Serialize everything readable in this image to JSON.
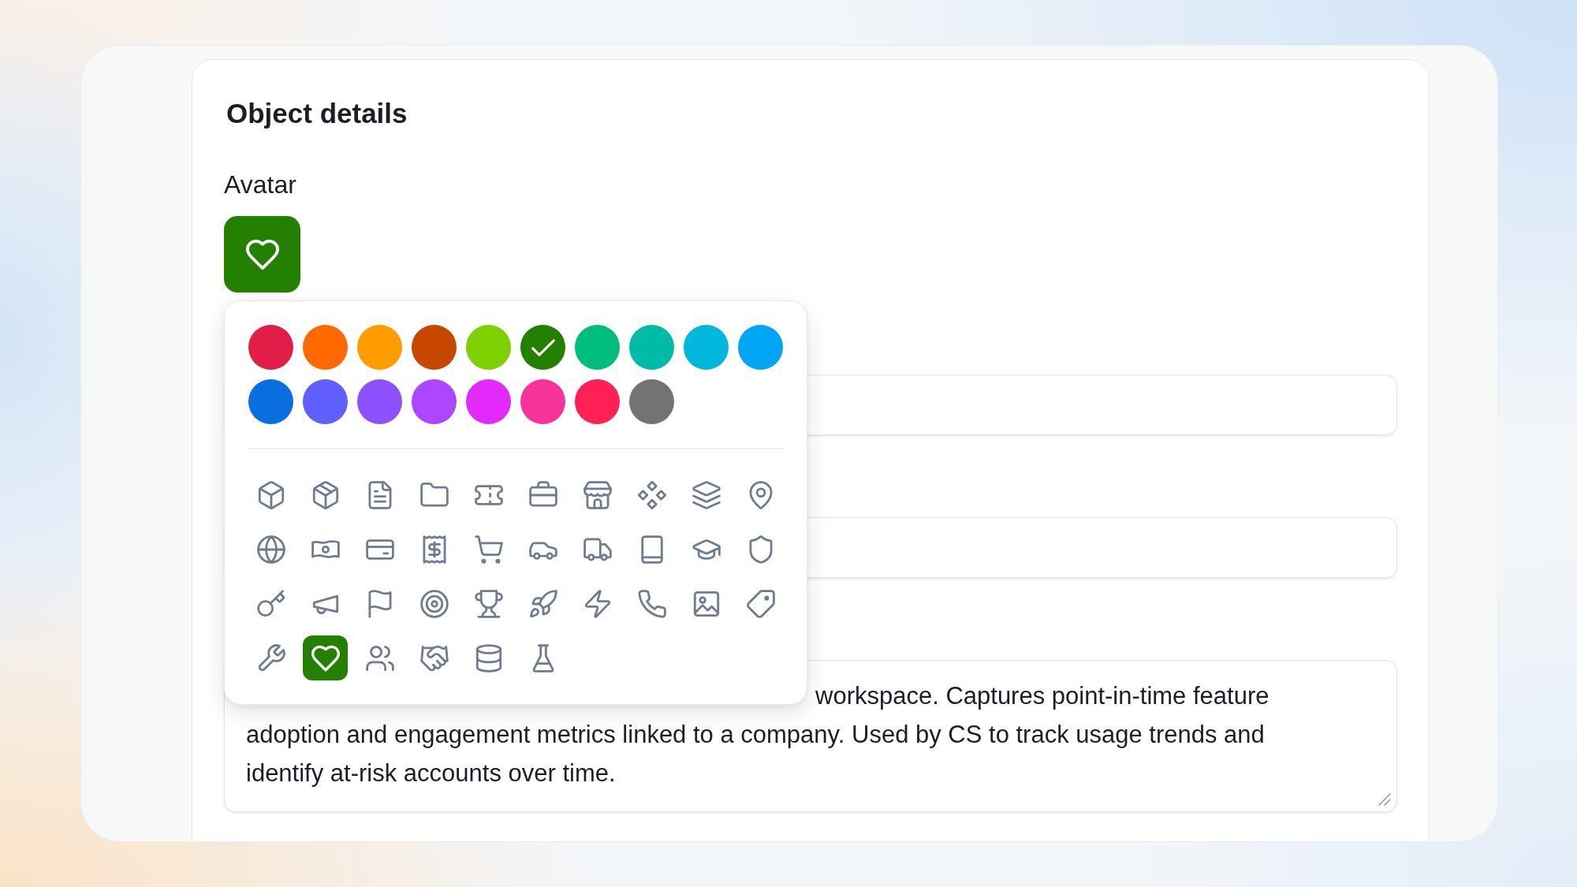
{
  "card": {
    "title": "Object details"
  },
  "avatar": {
    "label": "Avatar"
  },
  "picker": {
    "swatches": [
      {
        "color": "#e11d48",
        "selected": false
      },
      {
        "color": "#ff6900",
        "selected": false
      },
      {
        "color": "#ff9d00",
        "selected": false
      },
      {
        "color": "#c74600",
        "selected": false
      },
      {
        "color": "#7fd000",
        "selected": false
      },
      {
        "color": "#238000",
        "selected": true
      },
      {
        "color": "#00bc7d",
        "selected": false
      },
      {
        "color": "#00bba7",
        "selected": false
      },
      {
        "color": "#00b8db",
        "selected": false
      },
      {
        "color": "#00a6f4",
        "selected": false
      },
      {
        "color": "#0a6fde",
        "selected": false
      },
      {
        "color": "#615fff",
        "selected": false
      },
      {
        "color": "#8e51ff",
        "selected": false
      },
      {
        "color": "#ad46ff",
        "selected": false
      },
      {
        "color": "#e12afb",
        "selected": false
      },
      {
        "color": "#f6339a",
        "selected": false
      },
      {
        "color": "#ff2056",
        "selected": false
      },
      {
        "color": "#737373",
        "selected": false
      }
    ],
    "icons": [
      {
        "kind": "cube",
        "selected": false
      },
      {
        "kind": "package",
        "selected": false
      },
      {
        "kind": "document",
        "selected": false
      },
      {
        "kind": "folder",
        "selected": false
      },
      {
        "kind": "ticket",
        "selected": false
      },
      {
        "kind": "briefcase",
        "selected": false
      },
      {
        "kind": "store",
        "selected": false
      },
      {
        "kind": "diamonds",
        "selected": false
      },
      {
        "kind": "layers",
        "selected": false
      },
      {
        "kind": "pin",
        "selected": false
      },
      {
        "kind": "globe",
        "selected": false
      },
      {
        "kind": "banknote",
        "selected": false
      },
      {
        "kind": "card",
        "selected": false
      },
      {
        "kind": "receipt",
        "selected": false
      },
      {
        "kind": "cart",
        "selected": false
      },
      {
        "kind": "car",
        "selected": false
      },
      {
        "kind": "truck",
        "selected": false
      },
      {
        "kind": "book",
        "selected": false
      },
      {
        "kind": "cap",
        "selected": false
      },
      {
        "kind": "shield",
        "selected": false
      },
      {
        "kind": "key",
        "selected": false
      },
      {
        "kind": "megaphone",
        "selected": false
      },
      {
        "kind": "flag",
        "selected": false
      },
      {
        "kind": "target",
        "selected": false
      },
      {
        "kind": "trophy",
        "selected": false
      },
      {
        "kind": "rocket",
        "selected": false
      },
      {
        "kind": "lightning",
        "selected": false
      },
      {
        "kind": "phone",
        "selected": false
      },
      {
        "kind": "image",
        "selected": false
      },
      {
        "kind": "tag",
        "selected": false
      },
      {
        "kind": "wrench",
        "selected": false
      },
      {
        "kind": "heart",
        "selected": true
      },
      {
        "kind": "users",
        "selected": false
      },
      {
        "kind": "handshake",
        "selected": false
      },
      {
        "kind": "database",
        "selected": false
      },
      {
        "kind": "flask",
        "selected": false
      }
    ]
  },
  "fields": [
    {
      "kind": "input"
    },
    {
      "kind": "input"
    },
    {
      "kind": "textarea",
      "value_lines": [
        "workspace. Captures point-in-time feature",
        "adoption and engagement metrics linked to a company. Used by CS to track usage trends and",
        "identify at-risk accounts over time."
      ]
    }
  ]
}
